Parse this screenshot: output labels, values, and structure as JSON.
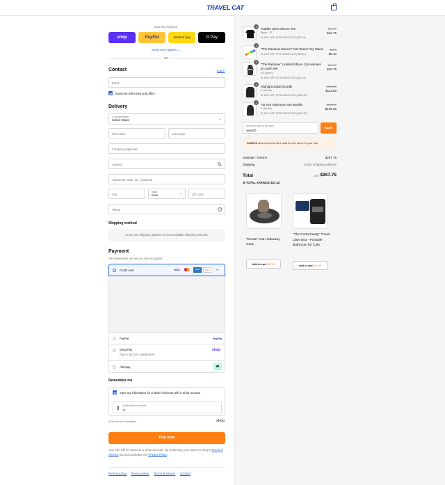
{
  "header": {
    "logo": "TRAVEL CAT"
  },
  "express": {
    "title": "Express checkout",
    "shop": "shop",
    "paypal": "PayPal",
    "amazon": "amazon pay",
    "gpay": "G Pay",
    "more": "Show more options",
    "or": "OR"
  },
  "contact": {
    "title": "Contact",
    "login": "Log in",
    "email_placeholder": "Email",
    "news": "Email me with news and offers"
  },
  "delivery": {
    "title": "Delivery",
    "country_label": "Country/Region",
    "country": "United States",
    "first": "First name",
    "last": "Last name",
    "company": "Company (optional)",
    "address": "Address",
    "apt": "Apartment, suite, etc. (optional)",
    "city": "City",
    "state_label": "State",
    "state": "Iowa",
    "zip": "ZIP code",
    "phone": "Phone"
  },
  "shipping": {
    "title": "Shipping method",
    "note": "Enter your shipping address to view available shipping methods."
  },
  "payment": {
    "title": "Payment",
    "sub": "All transactions are secure and encrypted.",
    "credit": "Credit card",
    "cards": [
      "VISA",
      "MC",
      "AMEX",
      "DISC"
    ],
    "more_cards": "+5",
    "paypal": "PayPal",
    "paypal_logo": "PayPal",
    "shoppay": "Shop Pay",
    "shoppay_sub": "Pay in full or in installments",
    "shoppay_logo": "shop",
    "afterpay": "Afterpay"
  },
  "remember": {
    "title": "Remember me",
    "save": "Save my information for a faster checkout with a Shop account",
    "phone_label": "Mobile phone number",
    "phone_value": "+1",
    "secure": "Secure and encrypted",
    "shop_logo": "shop"
  },
  "pay_button": "Pay now",
  "legal": {
    "text1": "Your info will be saved to a Shop account. By continuing, you agree to Shop's",
    "terms": "Terms of Service",
    "and": "and acknowledge the",
    "privacy": "Privacy Policy",
    "dot": "."
  },
  "footer": {
    "refund": "Refund policy",
    "privacy": "Privacy policy",
    "terms": "Terms of service",
    "contact": "Contact"
  },
  "items": [
    {
      "qty": "1",
      "name": "Toddler Short Sleeve Tee",
      "variant": "Black / 2T",
      "discount": "15% OFF SITE-WIDE EOS (-$2.24)",
      "old": "$14.99",
      "price": "$12.75"
    },
    {
      "qty": "1",
      "name": "\"The Rainbow Dancer\" Cat Teaser Toy Wand",
      "variant": "",
      "discount": "15% OFF SITE-WIDE EOS (-$0.90)",
      "old": "$6.00",
      "price": "$5.10"
    },
    {
      "qty": "1",
      "name": "\"The Rainbow\" Limited Edition Cat Harness & Leash Set",
      "variant": "XS (kitten)",
      "discount": "15% OFF SITE-WIDE EOS (-$5.24)",
      "old": "$34.99",
      "price": "$29.75"
    },
    {
      "qty": "1",
      "name": "Midnight Safari Bundle",
      "variant": "S (Small)",
      "discount": "15% OFF SITE-WIDE EOS (-$20.10)",
      "old": "$134.00",
      "price": "$113.90"
    },
    {
      "qty": "1",
      "name": "Fur-tive Adventure Set Bundle",
      "variant": "S (Small)",
      "discount": "15% OFF SITE-WIDE EOS (-$18.75)",
      "old": "$125.00",
      "price": "$106.25"
    }
  ],
  "discount": {
    "label": "Discount code or gift card",
    "value": "save20",
    "apply": "Apply",
    "error_code": "SAVE20",
    "error_rest": " discount code isn't valid for the items in your cart"
  },
  "totals": {
    "subtotal_label": "Subtotal · 5 items",
    "subtotal": "$267.75",
    "shipping_label": "Shipping",
    "shipping": "Enter shipping address",
    "total_label": "Total",
    "currency": "USD",
    "total": "$267.75",
    "savings_label": "TOTAL SAVINGS",
    "savings": "$47.22"
  },
  "upsell": [
    {
      "name": "\"Donut!\" Cat Hideaway Cave",
      "button": "Add to cart",
      "price": "$59.99"
    },
    {
      "name": "\"The Porta-Pawty\" Travel Litter Box - Portable Bathroom for Cats",
      "button": "Add to cart",
      "price": "$34.99"
    }
  ]
}
